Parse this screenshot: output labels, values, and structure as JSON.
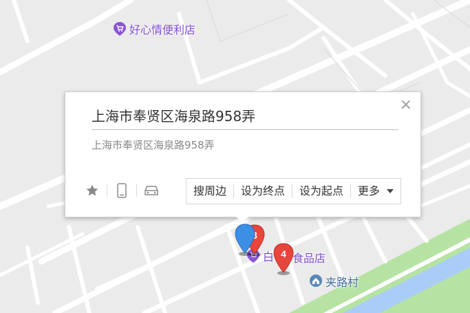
{
  "map": {
    "pois": [
      {
        "name": "好心情便利店",
        "icon": "shop-icon"
      },
      {
        "name": "白",
        "icon": "shop-icon"
      },
      {
        "name": "食品店",
        "icon": "shop-icon"
      },
      {
        "name": "夹路村",
        "icon": "village-icon"
      }
    ],
    "markers": [
      {
        "label": "",
        "color": "#3d8fe6"
      },
      {
        "label": "3",
        "color": "#e8453c"
      },
      {
        "label": "4",
        "color": "#e8453c"
      }
    ],
    "colors": {
      "background": "#ebebeb",
      "road": "#ffffff",
      "green": "#b6e3a3",
      "water": "#a9cdf7",
      "poi_text": "#7c4bc8"
    }
  },
  "popup": {
    "title": "上海市奉贤区海泉路958弄",
    "address": "上海市奉贤区海泉路958弄",
    "close_glyph": "×",
    "icons": [
      "star-icon",
      "phone-icon",
      "car-icon"
    ],
    "actions": {
      "search_nearby": "搜周边",
      "set_destination": "设为终点",
      "set_origin": "设为起点",
      "more": "更多"
    }
  }
}
